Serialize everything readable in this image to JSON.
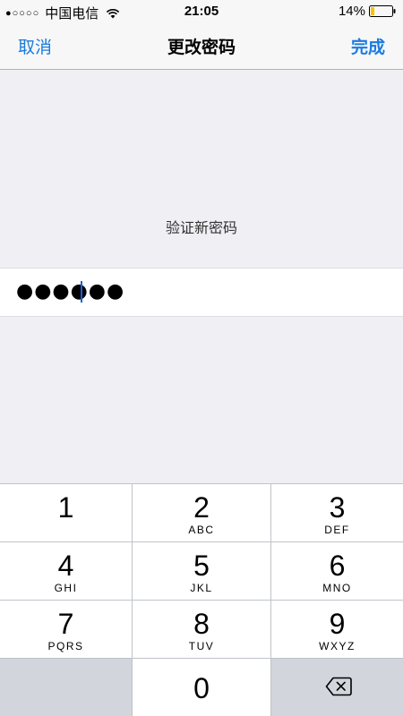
{
  "status_bar": {
    "signal": "●○○○○",
    "carrier": "中国电信",
    "time": "21:05",
    "battery": "14%"
  },
  "nav": {
    "cancel": "取消",
    "title": "更改密码",
    "done": "完成"
  },
  "prompt": "验证新密码",
  "password": {
    "masked": "●●●●●●"
  },
  "keypad": {
    "keys": [
      {
        "num": "1",
        "letters": ""
      },
      {
        "num": "2",
        "letters": "ABC"
      },
      {
        "num": "3",
        "letters": "DEF"
      },
      {
        "num": "4",
        "letters": "GHI"
      },
      {
        "num": "5",
        "letters": "JKL"
      },
      {
        "num": "6",
        "letters": "MNO"
      },
      {
        "num": "7",
        "letters": "PQRS"
      },
      {
        "num": "8",
        "letters": "TUV"
      },
      {
        "num": "9",
        "letters": "WXYZ"
      },
      {
        "num": "0",
        "letters": ""
      }
    ]
  },
  "colors": {
    "accent": "#1a7be0",
    "background": "#efeff4",
    "battery_fill": "#f5c400"
  },
  "icons": [
    "wifi-icon",
    "battery-icon",
    "delete-icon"
  ]
}
